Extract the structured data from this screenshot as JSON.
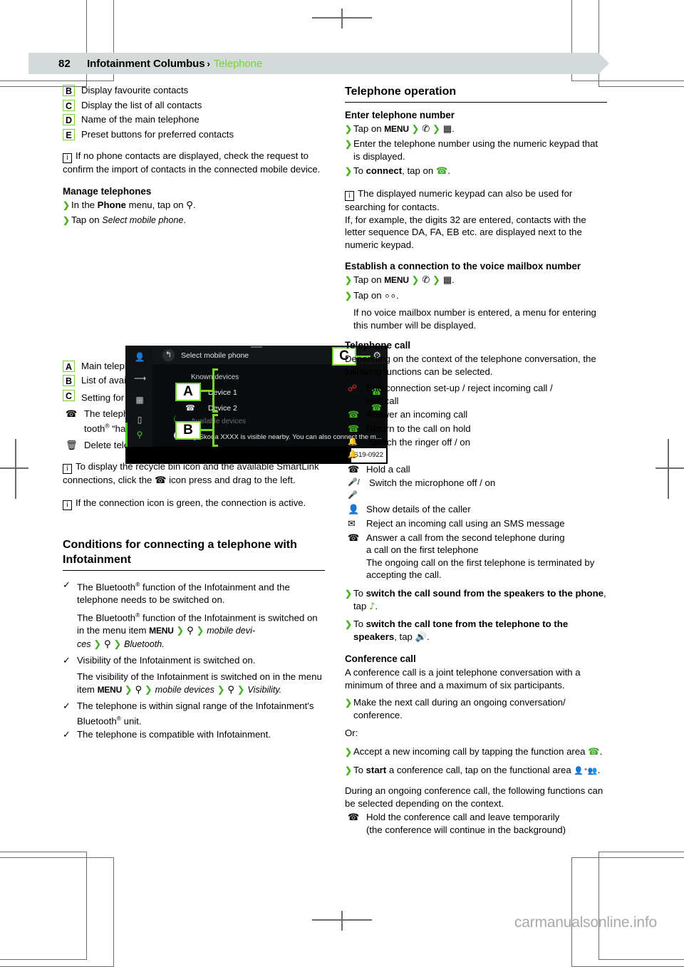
{
  "header": {
    "page_number": "82",
    "title": "Infotainment Columbus",
    "chevron": "›",
    "subtitle": "Telephone"
  },
  "left_column": {
    "callouts_top": [
      {
        "key": "B",
        "text": "Display favourite contacts"
      },
      {
        "key": "C",
        "text": "Display the list of all contacts"
      },
      {
        "key": "D",
        "text": "Name of the main telephone"
      },
      {
        "key": "E",
        "text": "Preset buttons for preferred contacts"
      }
    ],
    "note_contacts": "If no phone contacts are displayed, check the request to confirm the import of contacts in the connected mobile device.",
    "manage_heading": "Manage telephones",
    "manage_step1_pre": "In the ",
    "manage_step1_bold": "Phone",
    "manage_step1_post": " menu, tap on ",
    "manage_step1_icon": "⚲",
    "manage_step2_pre": "Tap on ",
    "manage_step2_italic": "Select mobile phone",
    "screenshot": {
      "title": "Select mobile phone",
      "known_devices_label": "Known devices",
      "devices": [
        {
          "name": "Device 1"
        },
        {
          "name": "Device 2"
        }
      ],
      "available_devices_label": "Available devices",
      "info_text": "My Skoda XXXX is visible nearby. You can also connect the m...",
      "image_code": "S19-0922",
      "overlay_letters": [
        "A",
        "B",
        "C"
      ],
      "back_icon": "↰",
      "gear_icon": "gear",
      "rail_icons": [
        "contact",
        "messages",
        "keypad",
        "voicemail",
        "bluetooth"
      ]
    },
    "callouts_shot": [
      {
        "key": "A",
        "text": "Main telephone, additional telephone and known devices"
      },
      {
        "key": "B",
        "text": "List of available telephones"
      },
      {
        "key": "C",
        "text": "Setting for the Infotainment Bluetooth® function"
      }
    ],
    "icon_legend": [
      {
        "icon": "handset",
        "text_a": "The telephone enables connection via the Blue-",
        "text_b": "tooth® “hands-free profile”"
      },
      {
        "icon": "trash",
        "text_a": "Delete telephone from the list of known devices",
        "text_b": ""
      }
    ],
    "note_recyclebin_1": "To display the recycle bin icon and the available SmartLink connections, click the ",
    "note_recyclebin_2": " icon press and drag to the left.",
    "note_connection_green": "If the connection icon is green, the connection is active.",
    "conditions_heading": "Conditions for connecting a telephone with Infotainment",
    "conditions": [
      {
        "check": "✓",
        "text": "The Bluetooth® function of the Infotainment and the telephone needs to be switched on.",
        "cont_pre": "The Bluetooth® function of the Infotainment is switched on in the menu item ",
        "cont_menu": "MENU",
        "cont_path": " ❯ ⚲ ❯ mobile devices ❯ ⚲ ❯ Bluetooth."
      },
      {
        "check": "✓",
        "text": "Visibility of the Infotainment is switched on.",
        "cont_pre": "The visibility of the Infotainment is switched on in the menu item ",
        "cont_menu": "MENU",
        "cont_path": " ❯ ⚲ ❯ mobile devices ❯ ⚲ ❯ Visibility."
      },
      {
        "check": "✓",
        "text": "The telephone is within signal range of the Infotainment's Bluetooth® unit.",
        "cont_pre": "",
        "cont_menu": "",
        "cont_path": ""
      },
      {
        "check": "✓",
        "text": "The telephone is compatible with Infotainment.",
        "cont_pre": "",
        "cont_menu": "",
        "cont_path": ""
      }
    ]
  },
  "right_column": {
    "operation_heading": "Telephone operation",
    "enter_number_heading": "Enter telephone number",
    "enter_steps": [
      {
        "pre": "Tap on ",
        "menu": "MENU",
        "path": " ❯ ✆ ❯ ⌗."
      },
      {
        "pre": "Enter the telephone number using the numeric keypad that is displayed.",
        "menu": "",
        "path": ""
      },
      {
        "pre": "To ",
        "bold": "connect",
        "post": ", tap on ",
        "icon": "📞",
        "path": ""
      }
    ],
    "note_keypad_line1": "The displayed numeric keypad can also be used for searching for contacts.",
    "note_keypad_line2": "If, for example, the digits 32 are entered, contacts with the letter sequence DA, FA, EB etc. are displayed next to the numeric keypad.",
    "voicemail_heading": "Establish a connection to the voice mailbox number",
    "voicemail_steps": [
      {
        "pre": "Tap on ",
        "menu": "MENU",
        "path": " ❯ ✆ ❯ ⌗."
      },
      {
        "pre": "Tap on ",
        "menu": "",
        "path": "◉◉."
      }
    ],
    "voicemail_note": "If no voice mailbox number is entered, a menu for entering this number will be displayed.",
    "call_heading": "Telephone call",
    "call_intro": "Depending on the context of the telephone conversation, the following functions can be selected.",
    "call_functions": [
      {
        "icon": "end-call",
        "glyph": "⌒",
        "text_a": "End connection set-up / reject incoming call /",
        "text_b": "end call"
      },
      {
        "icon": "answer-call",
        "glyph": "✆",
        "text_a": "Answer an incoming call",
        "text_b": ""
      },
      {
        "icon": "return-held-call",
        "glyph": "✆",
        "text_a": "Return to the call on hold",
        "text_b": ""
      },
      {
        "icon": "ringer-toggle",
        "glyph": "🔔",
        "text_a": "Switch the ringer off / on",
        "text_b": ""
      },
      {
        "icon": "hold-call",
        "glyph": "✆",
        "text_a": "Hold a call",
        "text_b": ""
      },
      {
        "icon": "microphone-toggle",
        "glyph": "🎤",
        "text_a": "Switch the microphone off / on",
        "text_b": ""
      },
      {
        "icon": "caller-details",
        "glyph": "👤",
        "text_a": "Show details of the caller",
        "text_b": ""
      },
      {
        "icon": "reject-sms",
        "glyph": "✉",
        "text_a": "Reject an incoming call using an SMS message",
        "text_b": ""
      },
      {
        "icon": "second-call",
        "glyph": "✆",
        "text_a": "Answer a call from the second telephone during",
        "text_b": "a call on the first telephone"
      }
    ],
    "call_functions_extra": "The ongoing call on the first telephone is terminated by accepting the call.",
    "switch_to_phone_pre": "To ",
    "switch_to_phone_bold": "switch the call sound from the speakers to the phone",
    "switch_to_phone_post": ", tap ",
    "switch_to_phone_icon": "📱",
    "switch_to_speakers_pre": "To ",
    "switch_to_speakers_bold": "switch the call tone from the telephone to the speakers",
    "switch_to_speakers_post": ", tap ",
    "switch_to_speakers_icon": "🔊",
    "conference_heading": "Conference call",
    "conference_intro": "A conference call is a joint telephone conversation with a minimum of three and a maximum of six participants.",
    "conference_steps": [
      {
        "text": "Make the next call during an ongoing conversation/ conference."
      }
    ],
    "conference_or": "Or:",
    "conference_accept_pre": "Accept a new incoming call by tapping the function area ",
    "conference_accept_icon": "✆",
    "conference_accept_post": ".",
    "conference_start_pre": "To ",
    "conference_start_bold": "start",
    "conference_start_post": " a conference call, tap on the functional area ",
    "conference_start_icon": "👤⁺👥",
    "conference_during": "During an ongoing conference call, the following functions can be selected depending on the context.",
    "conference_functions": [
      {
        "icon": "hold-conference",
        "glyph": "✆",
        "text_a": "Hold the conference call and leave temporarily",
        "text_b": "(the conference will continue in the background)"
      }
    ]
  },
  "watermark": "carmanualsonline.info",
  "colors": {
    "accent_green": "#77d430",
    "link_green": "#77d430",
    "header_bg": "#d3dad9",
    "red": "#e03028"
  }
}
